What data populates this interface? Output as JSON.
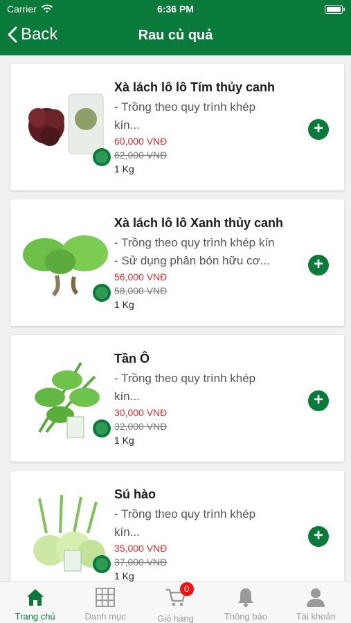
{
  "status_bar": {
    "carrier": "Carrier",
    "time": "6:36 PM"
  },
  "nav": {
    "back_label": "Back",
    "title": "Rau củ quả"
  },
  "products": [
    {
      "title": "Xà lách lô lô Tím thủy canh",
      "desc_line1": "- Trồng theo quy trình khép",
      "desc_line2": "kín...",
      "price": "60,000 VNĐ",
      "old_price": "62,000 VNĐ",
      "unit": "1 Kg"
    },
    {
      "title": "Xà lách lô lô Xanh thủy canh",
      "desc_line1": "- Trồng theo quy trình khép kín",
      "desc_line2": "- Sử dụng phân bón hữu cơ...",
      "price": "56,000 VNĐ",
      "old_price": "58,000 VNĐ",
      "unit": "1 Kg"
    },
    {
      "title": "Tần Ô",
      "desc_line1": "- Trồng theo quy trình khép",
      "desc_line2": "kín...",
      "price": "30,000 VNĐ",
      "old_price": "32,000 VNĐ",
      "unit": "1 Kg"
    },
    {
      "title": "Sú hào",
      "desc_line1": "- Trồng theo quy trình khép",
      "desc_line2": "kín...",
      "price": "35,000 VNĐ",
      "old_price": "37,000 VNĐ",
      "unit": "1 Kg"
    }
  ],
  "tabbar": {
    "home": "Trang chủ",
    "category": "Danh mục",
    "cart": "Giỏ hàng",
    "cart_badge": "0",
    "notifications": "Thông báo",
    "account": "Tài khoản"
  },
  "colors": {
    "brand": "#0a7a3b",
    "price": "#e22a2a"
  }
}
